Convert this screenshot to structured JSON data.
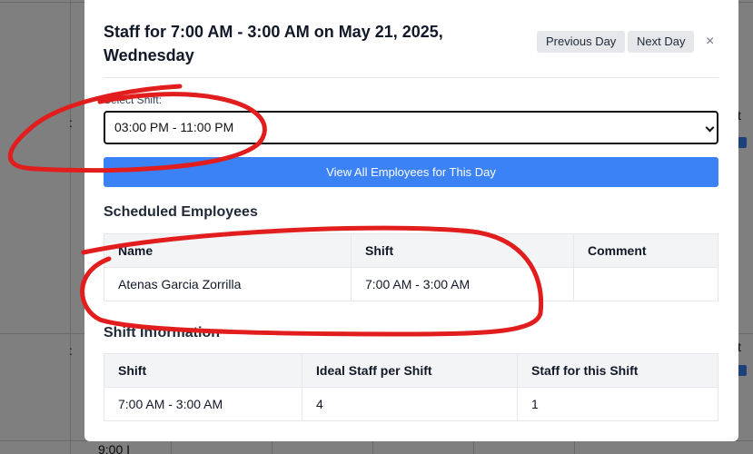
{
  "modal": {
    "title": "Staff for 7:00 AM - 3:00 AM on May 21, 2025, Wednesday",
    "previous_day_label": "Previous Day",
    "next_day_label": "Next Day",
    "close_label": "×",
    "select_shift_label": "Select Shift:",
    "selected_shift": "03:00 PM - 11:00 PM",
    "view_all_label": "View All Employees for This Day"
  },
  "scheduled": {
    "title": "Scheduled Employees",
    "headers": [
      "Name",
      "Shift",
      "Comment"
    ],
    "rows": [
      [
        "Atenas Garcia Zorrilla",
        "7:00 AM - 3:00 AM",
        ""
      ]
    ]
  },
  "shift_info": {
    "title": "Shift Information",
    "headers": [
      "Shift",
      "Ideal Staff per Shift",
      "Staff for this Shift"
    ],
    "rows": [
      [
        "7:00 AM - 3:00 AM",
        "4",
        "1"
      ]
    ]
  },
  "background": {
    "text_a": "t",
    "text_b": "t",
    "text_c": "9:00 I"
  },
  "colors": {
    "primary": "#3b82f6",
    "annotation": "#e11d1d"
  }
}
